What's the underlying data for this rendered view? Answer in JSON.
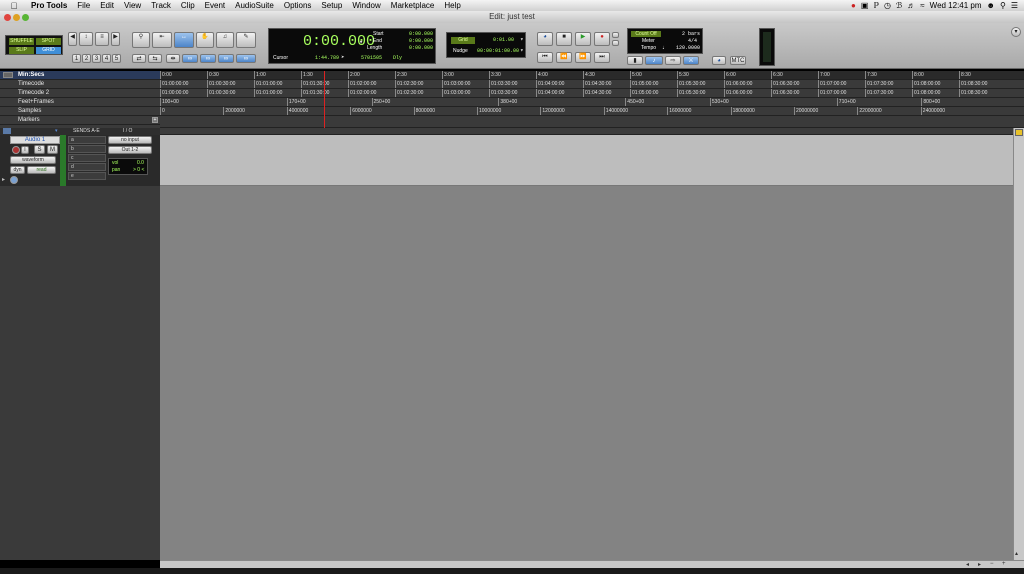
{
  "menubar": {
    "app": "Pro Tools",
    "items": [
      "File",
      "Edit",
      "View",
      "Track",
      "Clip",
      "Event",
      "AudioSuite",
      "Options",
      "Setup",
      "Window",
      "Marketplace",
      "Help"
    ],
    "clock": "Wed 12:41 pm"
  },
  "window": {
    "title": "Edit: just test"
  },
  "modes": {
    "shuffle": "SHUFFLE",
    "spot": "SPOT",
    "slip": "SLIP",
    "grid": "GRID"
  },
  "zoom_presets": [
    "1",
    "2",
    "3",
    "4",
    "5"
  ],
  "counter": {
    "main": "0:00.000",
    "start_label": "Start",
    "start": "0:00.000",
    "end_label": "End",
    "end": "0:00.000",
    "length_label": "Length",
    "length": "0:00.000",
    "cursor_label": "Cursor",
    "cursor": "1:44.789",
    "samples": "5701505",
    "dly": "Dly"
  },
  "grid": {
    "grid_label": "Grid",
    "grid_value": "0:01.00",
    "nudge_label": "Nudge",
    "nudge_value": "00:00:01:00.00"
  },
  "midi": {
    "countoff_label": "Count Off",
    "countoff": "2 bars",
    "meter_label": "Meter",
    "meter": "4/4",
    "tempo_label": "Tempo",
    "tempo": "120.0000",
    "mtc": "MTC"
  },
  "rulers": {
    "names": [
      "Min:Secs",
      "Timecode",
      "Timecode 2",
      "Feet+Frames",
      "Samples",
      "Markers"
    ],
    "minsecs": [
      "0:00",
      "0:30",
      "1:00",
      "1:30",
      "2:00",
      "2:30",
      "3:00",
      "3:30",
      "4:00",
      "4:30",
      "5:00",
      "5:30",
      "6:00",
      "6:30",
      "7:00",
      "7:30",
      "8:00",
      "8:30"
    ],
    "timecode": [
      "01:00:00:00",
      "01:00:30:00",
      "01:01:00:00",
      "01:01:30:00",
      "01:02:00:00",
      "01:02:30:00",
      "01:03:00:00",
      "01:03:30:00",
      "01:04:00:00",
      "01:04:30:00",
      "01:05:00:00",
      "01:05:30:00",
      "01:06:00:00",
      "01:06:30:00",
      "01:07:00:00",
      "01:07:30:00",
      "01:08:00:00",
      "01:08:30:00"
    ],
    "feetframes": [
      "100+00",
      "",
      "",
      "170+00",
      "",
      "250+00",
      "",
      "",
      "380+00",
      "",
      "",
      "450+00",
      "",
      "530+00",
      "",
      "",
      "710+00",
      "",
      "800+00"
    ],
    "samples": [
      "0",
      "",
      "2000000",
      "",
      "4000000",
      "",
      "6000000",
      "",
      "8000000",
      "",
      "10000000",
      "",
      "12000000",
      "",
      "14000000",
      "",
      "16000000",
      "",
      "18000000",
      "",
      "20000000",
      "",
      "22000000",
      "",
      "24000000"
    ]
  },
  "mix_header": {
    "sends": "SENDS A-E",
    "io": "I / O"
  },
  "track": {
    "name": "Audio 1",
    "s": "S",
    "m": "M",
    "view": "waveform",
    "dyn": "dyn",
    "read": "read",
    "input": "no input",
    "output": "Out 1-2",
    "vol_label": "vol",
    "vol": "0.0",
    "pan_label": "pan",
    "pan": "> 0 <",
    "sends": [
      "a",
      "b",
      "c",
      "d",
      "e"
    ]
  }
}
